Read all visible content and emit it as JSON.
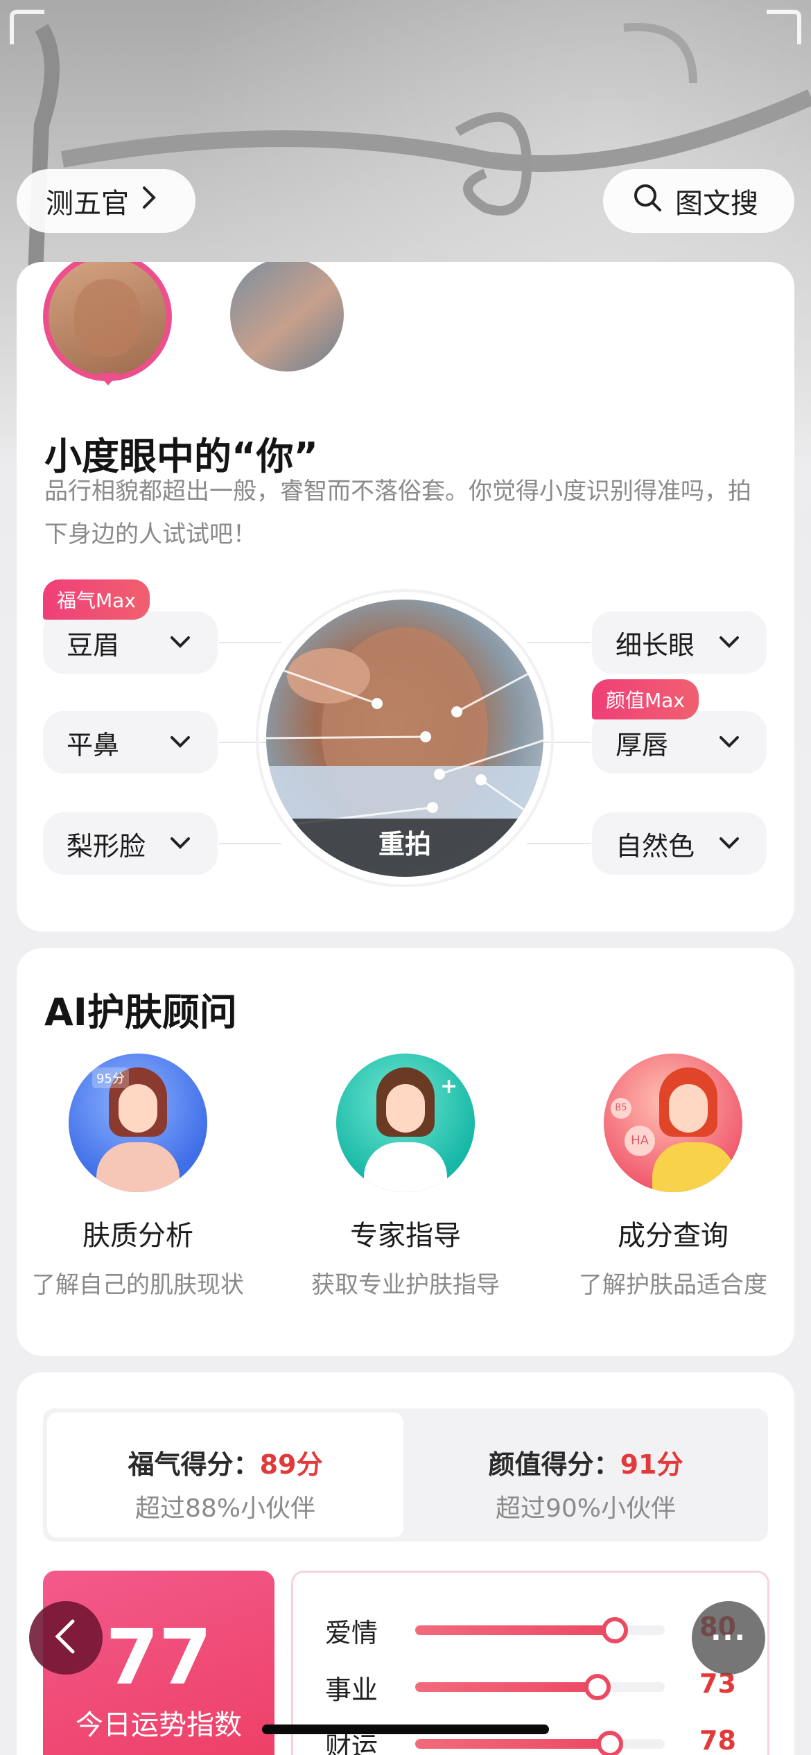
{
  "top_bar": {
    "left_button": "测五官",
    "right_button": "图文搜",
    "icons": [
      "chevron-right-icon",
      "search-icon"
    ]
  },
  "face_card": {
    "title": "小度眼中的“你”",
    "description": "品行相貌都超出一般，睿智而不落俗套。你觉得小度识别得准吗，拍下身边的人试试吧！",
    "retake_label": "重拍",
    "left_features": [
      {
        "label": "豆眉",
        "badge": "福气Max"
      },
      {
        "label": "平鼻"
      },
      {
        "label": "梨形脸"
      }
    ],
    "right_features": [
      {
        "label": "细长眼"
      },
      {
        "label": "厚唇",
        "badge": "颜值Max"
      },
      {
        "label": "自然色"
      }
    ],
    "colors": {
      "accent": "#ec4f8c",
      "badge": "#ef3f79"
    }
  },
  "skin_card": {
    "title": "AI护肤顾问",
    "items": [
      {
        "name": "肤质分析",
        "sub": "了解自己的肌肤现状",
        "icon": "skin-analysis-illustration",
        "score_tag": "95分"
      },
      {
        "name": "专家指导",
        "sub": "获取专业护肤指导",
        "icon": "doctor-illustration"
      },
      {
        "name": "成分查询",
        "sub": "了解护肤品适合度",
        "icon": "ingredient-illustration",
        "tags": [
          "B5",
          "HA"
        ]
      }
    ]
  },
  "score_card": {
    "tabs": [
      {
        "label": "福气得分：",
        "score": "89分",
        "sub": "超过88%小伙伴",
        "active": true
      },
      {
        "label": "颜值得分：",
        "score": "91分",
        "sub": "超过90%小伙伴",
        "active": false
      }
    ],
    "fortune": {
      "value": "77",
      "label": "今日运势指数"
    },
    "bars": [
      {
        "label": "爱情",
        "value": "80",
        "fraction": 0.8
      },
      {
        "label": "事业",
        "value": "73",
        "fraction": 0.73
      },
      {
        "label": "财运",
        "value": "78",
        "fraction": 0.78
      }
    ],
    "colors": {
      "score": "#e23a3a",
      "fortune_bg": "#ec3d62"
    }
  },
  "floating": {
    "more_label": "···",
    "icons": [
      "back-icon",
      "more-icon"
    ]
  }
}
